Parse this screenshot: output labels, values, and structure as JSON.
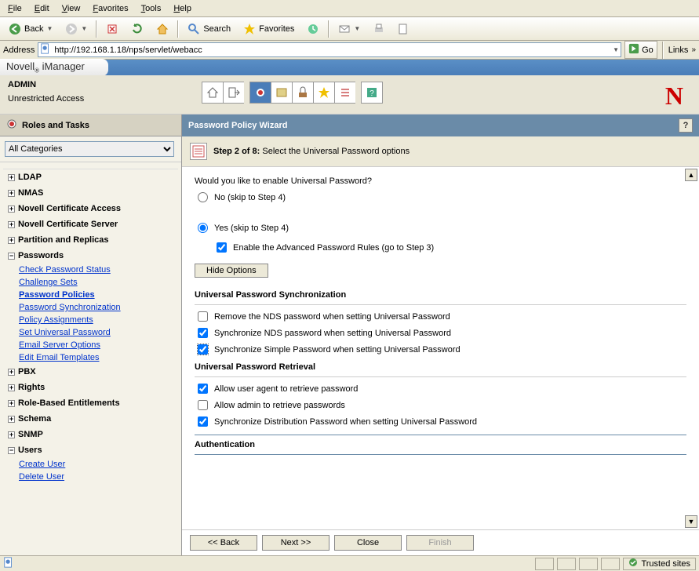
{
  "menubar": [
    "File",
    "Edit",
    "View",
    "Favorites",
    "Tools",
    "Help"
  ],
  "toolbar": {
    "back": "Back",
    "search": "Search",
    "favorites": "Favorites"
  },
  "address": {
    "label": "Address",
    "url": "http://192.168.1.18/nps/servlet/webacc",
    "go": "Go",
    "links": "Links"
  },
  "brand": {
    "name": "Novell",
    "product": "iManager"
  },
  "admin": {
    "label": "ADMIN",
    "access": "Unrestricted Access"
  },
  "sidebar": {
    "title": "Roles and Tasks",
    "category": "All Categories",
    "items": [
      {
        "label": "LDAP",
        "expanded": false
      },
      {
        "label": "NMAS",
        "expanded": false
      },
      {
        "label": "Novell Certificate Access",
        "expanded": false
      },
      {
        "label": "Novell Certificate Server",
        "expanded": false
      },
      {
        "label": "Partition and Replicas",
        "expanded": false
      },
      {
        "label": "Passwords",
        "expanded": true,
        "links": [
          "Check Password Status",
          "Challenge Sets",
          "Password Policies",
          "Password Synchronization",
          "Policy Assignments",
          "Set Universal Password",
          "Email Server Options",
          "Edit Email Templates"
        ]
      },
      {
        "label": "PBX",
        "expanded": false
      },
      {
        "label": "Rights",
        "expanded": false
      },
      {
        "label": "Role-Based Entitlements",
        "expanded": false
      },
      {
        "label": "Schema",
        "expanded": false
      },
      {
        "label": "SNMP",
        "expanded": false
      },
      {
        "label": "Users",
        "expanded": true,
        "links": [
          "Create User",
          "Delete User"
        ]
      }
    ]
  },
  "wizard": {
    "title": "Password Policy Wizard",
    "step_label": "Step 2 of 8:",
    "step_desc": "Select the Universal Password options",
    "question": "Would you like to enable Universal Password?",
    "no_label": "No   (skip to Step 4)",
    "yes_label": "Yes   (skip to Step 4)",
    "adv_label": "Enable the Advanced Password Rules  (go to Step 3)",
    "hide_btn": "Hide Options",
    "sync_h": "Universal Password Synchronization",
    "sync_opts": [
      {
        "label": "Remove the NDS password when setting Universal Password",
        "checked": false
      },
      {
        "label": "Synchronize NDS password when setting Universal Password",
        "checked": true
      },
      {
        "label": "Synchronize Simple Password when setting Universal Password",
        "checked": true,
        "hl": true
      }
    ],
    "retr_h": "Universal Password Retrieval",
    "retr_opts": [
      {
        "label": "Allow user agent to retrieve password",
        "checked": true
      },
      {
        "label": "Allow admin to retrieve passwords",
        "checked": false
      },
      {
        "label": "Synchronize Distribution Password when setting Universal Password",
        "checked": true
      }
    ],
    "auth_h": "Authentication",
    "btns": {
      "back": "<< Back",
      "next": "Next >>",
      "close": "Close",
      "finish": "Finish"
    }
  },
  "status": {
    "trusted": "Trusted sites"
  }
}
